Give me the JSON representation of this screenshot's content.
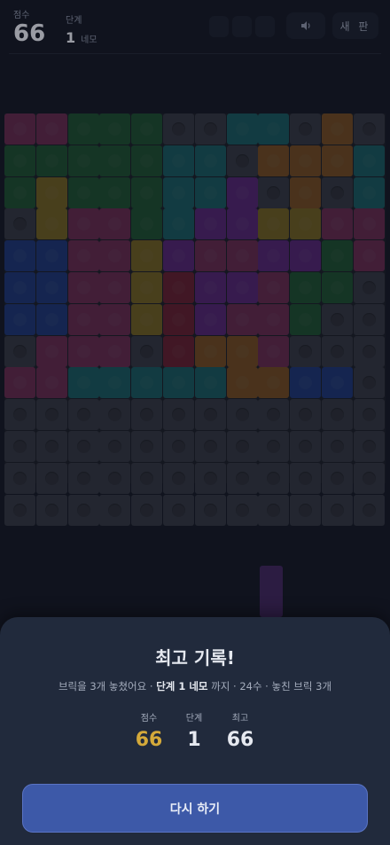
{
  "header": {
    "score_label": "점수",
    "score_value": "66",
    "level_label": "단계",
    "level_value": "1",
    "level_name": "네모",
    "new_game_label": "새 판"
  },
  "board": {
    "cols": 12,
    "rows": 12,
    "empty_color": "#323641",
    "palette": {
      "R": "#c23a7e",
      "G": "#1e8b3a",
      "T": "#13a3a3",
      "O": "#e0831a",
      "Y": "#d9b21a",
      "P": "#9a2ed1",
      "B": "#2054d8",
      "D": "#c0203a"
    },
    "grid": [
      "RRGGG..TT.O.",
      "GGGGGTT.OOOT",
      "GYGGGTTP.O.T",
      ".YRRGTPPYYRR",
      "BBRRYPRRPPGR",
      "BBRRYDPPRGG.",
      "BBRRYDPRRG..",
      ".RRR.DOOR...",
      "RRTTTTTOOBB.",
      "............",
      "............",
      "............",
      "............"
    ]
  },
  "dialog": {
    "title": "최고 기록!",
    "sub_before": "브릭을 3개 놓쳤어요 · ",
    "sub_bold": "단계 1 네모",
    "sub_after": " 까지 · 24수 · 놓친 브릭 3개",
    "stats": [
      {
        "label": "점수",
        "value": "66",
        "highlight": true
      },
      {
        "label": "단계",
        "value": "1",
        "highlight": false
      },
      {
        "label": "최고",
        "value": "66",
        "highlight": false
      }
    ],
    "retry_label": "다시 하기"
  }
}
